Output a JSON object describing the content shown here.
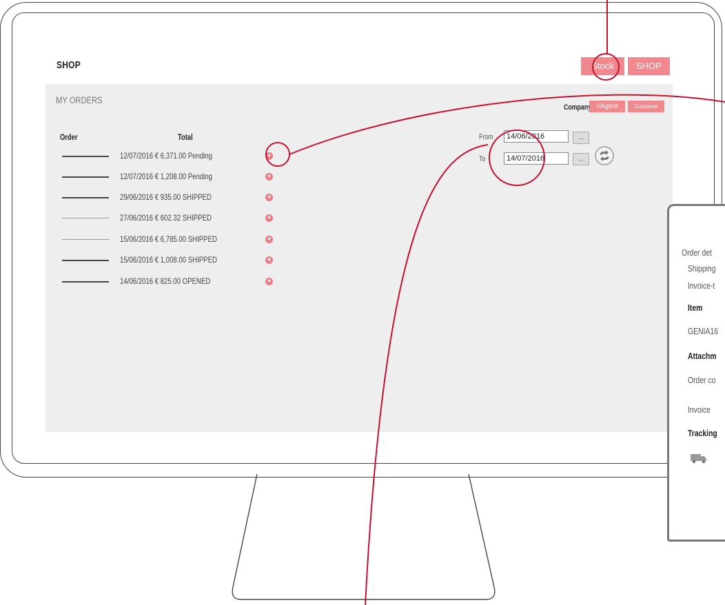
{
  "header": {
    "title": "SHOP",
    "stock_label": "Stock",
    "shop_label": "SHOP"
  },
  "orders_panel": {
    "title": "MY ORDERS",
    "company_label": "Company",
    "agent_label": "√Agent",
    "customer_label": "Customer",
    "columns": {
      "order": "Order",
      "total": "Total"
    },
    "rows": [
      {
        "text": "12/07/2016  € 6,371.00  Pending"
      },
      {
        "text": "12/07/2016  € 1,208.00  Pending"
      },
      {
        "text": "29/06/2016    € 935.00  SHIPPED"
      },
      {
        "text": "27/06/2016    € 602.32  SHIPPED"
      },
      {
        "text": "15/06/2016  € 6,785.00  SHIPPED"
      },
      {
        "text": "15/06/2016  € 1,008.00  SHIPPED"
      },
      {
        "text": "14/06/2016    € 825.00  OPENED"
      }
    ]
  },
  "date_filter": {
    "from_label": "From",
    "from_value": "14/06/2016",
    "to_label": "To",
    "to_value": "14/07/2016",
    "picker_label": "..."
  },
  "order_detail": {
    "order_det": "Order det",
    "shipping": "Shipping",
    "invoice_t": "Invoice-t",
    "item": "Item",
    "item_code": "GENIA16",
    "attachments": "Attachm",
    "order_co": "Order co",
    "invoice": "Invoice",
    "tracking": "Tracking"
  },
  "colors": {
    "accent": "#f0888e",
    "annotation": "#c8102e",
    "panel_bg": "#eeeeee"
  },
  "icons": [
    "plus-circle-icon",
    "refresh-icon",
    "truck-icon",
    "calendar-picker-icon"
  ]
}
